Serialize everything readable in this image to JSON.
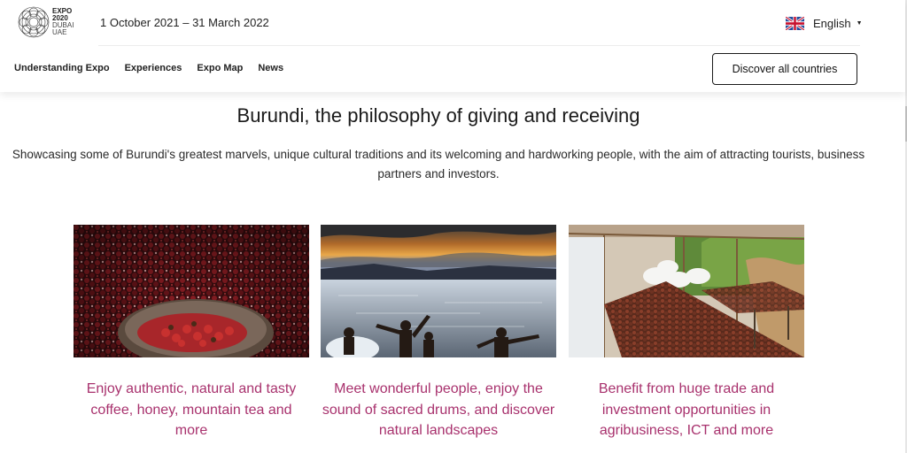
{
  "header": {
    "logo": {
      "line1": "EXPO",
      "line2": "2020",
      "line3": "DUBAI",
      "line4": "UAE"
    },
    "dates": "1 October 2021 – 31 March 2022",
    "language": {
      "label": "English",
      "flag_icon": "uk-flag-icon",
      "caret_icon": "caret-down-icon"
    }
  },
  "nav": {
    "items": [
      {
        "label": "Understanding Expo"
      },
      {
        "label": "Experiences"
      },
      {
        "label": "Expo Map"
      },
      {
        "label": "News"
      }
    ],
    "cta_label": "Discover all countries"
  },
  "main": {
    "title": "Burundi, the philosophy of giving and receiving",
    "subtitle": "Showcasing some of Burundi's greatest marvels, unique cultural traditions and its welcoming and hardworking people, with the aim of attracting tourists, business partners and investors.",
    "cards": [
      {
        "image": "coffee-cherries-bowl-image",
        "text": "Enjoy authentic, natural and tasty coffee, honey, mountain tea and more"
      },
      {
        "image": "lake-sunset-children-image",
        "text": "Meet wonderful people, enjoy the sound of sacred drums, and discover natural landscapes"
      },
      {
        "image": "coffee-drying-beds-image",
        "text": "Benefit from huge trade and investment opportunities in agribusiness, ICT and more"
      }
    ]
  },
  "colors": {
    "accent": "#a8316d",
    "text": "#1a1a1a"
  }
}
